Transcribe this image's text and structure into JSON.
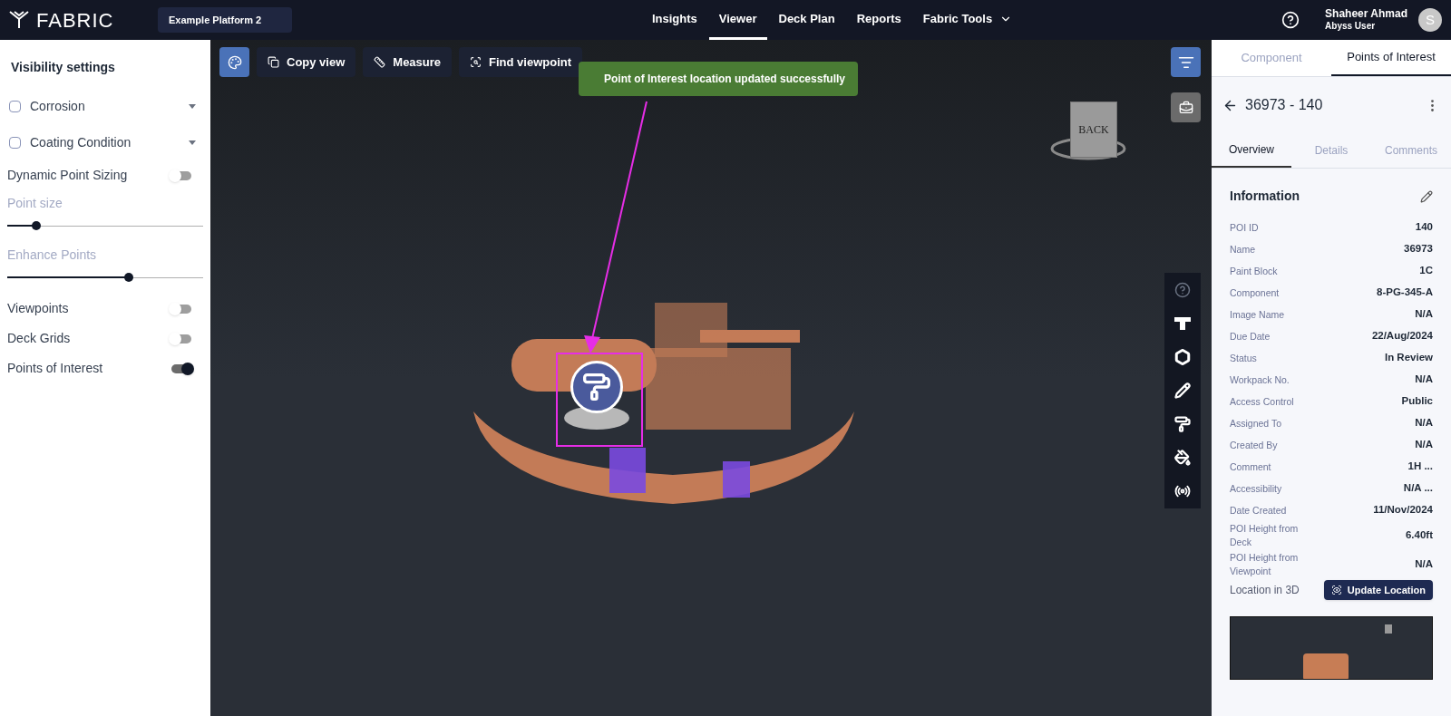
{
  "topbar": {
    "logo": "FABRIC",
    "platform": "Example Platform 2",
    "nav": [
      {
        "label": "Insights",
        "selected": false
      },
      {
        "label": "Viewer",
        "selected": true
      },
      {
        "label": "Deck Plan",
        "selected": false
      },
      {
        "label": "Reports",
        "selected": false
      },
      {
        "label": "Fabric Tools",
        "selected": false,
        "dropdown": true
      }
    ],
    "user": {
      "name": "Shaheer Ahmad",
      "role": "Abyss User",
      "initial": "S"
    }
  },
  "sidebar": {
    "title": "Visibility settings",
    "items": [
      {
        "kind": "checkbox",
        "label": "Corrosion",
        "checked": false
      },
      {
        "kind": "checkbox",
        "label": "Coating Condition",
        "checked": false
      },
      {
        "kind": "toggle",
        "label": "Dynamic Point Sizing",
        "on": false
      },
      {
        "kind": "slider",
        "label": "Point size",
        "level": 0.15
      },
      {
        "kind": "slider",
        "label": "Enhance Points",
        "level": 0.62
      },
      {
        "kind": "toggle",
        "label": "Viewpoints",
        "on": false
      },
      {
        "kind": "toggle",
        "label": "Deck Grids",
        "on": false
      },
      {
        "kind": "toggle",
        "label": "Points of Interest",
        "on": true
      }
    ]
  },
  "toolbar": [
    {
      "kind": "palette",
      "selected": true
    },
    {
      "kind": "copy",
      "label": "Copy view",
      "selected": false
    },
    {
      "kind": "measure",
      "label": "Measure",
      "selected": false
    },
    {
      "kind": "find",
      "label": "Find viewpoint",
      "selected": false
    }
  ],
  "toast": "Point of Interest location updated successfully",
  "viewcube": {
    "face": "BACK"
  },
  "tools": [
    {
      "kind": "help"
    },
    {
      "kind": "tee"
    },
    {
      "kind": "hexagon"
    },
    {
      "kind": "pencil"
    },
    {
      "kind": "roller"
    },
    {
      "kind": "bucket"
    },
    {
      "kind": "broadcast"
    }
  ],
  "panel": {
    "tabs": [
      {
        "label": "Component",
        "selected": false
      },
      {
        "label": "Points of Interest",
        "selected": true
      }
    ],
    "title": "36973 - 140",
    "subtabs": [
      {
        "label": "Overview",
        "selected": true
      },
      {
        "label": "Details",
        "selected": false
      },
      {
        "label": "Comments",
        "selected": false
      }
    ],
    "section": "Information",
    "fields": [
      {
        "label": "POI ID",
        "value": "140"
      },
      {
        "label": "Name",
        "value": "36973"
      },
      {
        "label": "Paint Block",
        "value": "1C"
      },
      {
        "label": "Component",
        "value": "8-PG-345-A"
      },
      {
        "label": "Image Name",
        "value": "N/A"
      },
      {
        "label": "Due Date",
        "value": "22/Aug/2024"
      },
      {
        "label": "Status",
        "value": "In Review"
      },
      {
        "label": "Workpack No.",
        "value": "N/A"
      },
      {
        "label": "Access Control",
        "value": "Public"
      },
      {
        "label": "Assigned To",
        "value": "N/A"
      },
      {
        "label": "Created By",
        "value": "N/A"
      },
      {
        "label": "Comment",
        "value": "1H ..."
      },
      {
        "label": "Accessibility",
        "value": "N/A ..."
      },
      {
        "label": "Date Created",
        "value": "11/Nov/2024"
      },
      {
        "label": "POI Height from Deck",
        "value": "6.40ft"
      },
      {
        "label": "POI Height from Viewpoint",
        "value": "N/A"
      }
    ],
    "location_label": "Location in 3D",
    "update_button": "Update Location"
  }
}
